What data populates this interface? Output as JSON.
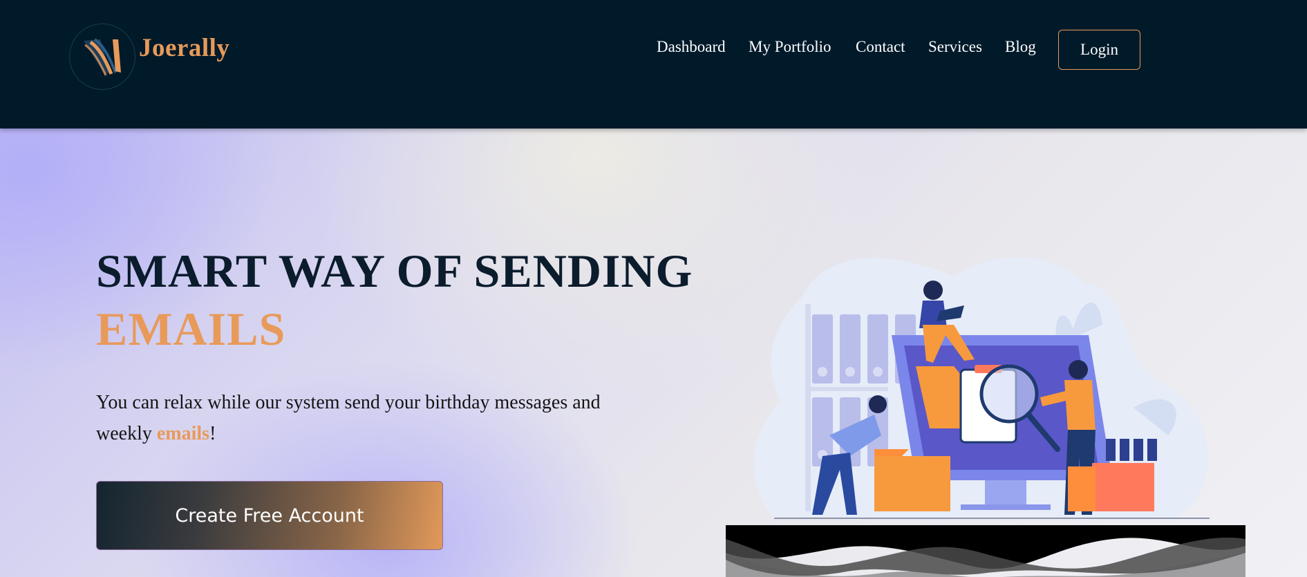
{
  "brand": {
    "name": "Joerally"
  },
  "nav": {
    "items": [
      {
        "label": "Dashboard"
      },
      {
        "label": "My Portfolio"
      },
      {
        "label": "Contact"
      },
      {
        "label": "Services"
      },
      {
        "label": "Blog"
      }
    ],
    "login_label": "Login"
  },
  "hero": {
    "headline_line1": "SMART WAY OF SENDING",
    "headline_line2": "EMAILS",
    "subtext_before": "You can relax while our system send your birthday messages and weekly ",
    "subtext_accent": "emails",
    "subtext_after": "!",
    "cta_label": "Create Free Account"
  },
  "colors": {
    "header_bg": "#001a2a",
    "accent": "#e89a5a",
    "headline": "#0b1c2c"
  },
  "icons": {
    "logo": "brand-logo-icon",
    "illustration": "file-search-illustration"
  }
}
